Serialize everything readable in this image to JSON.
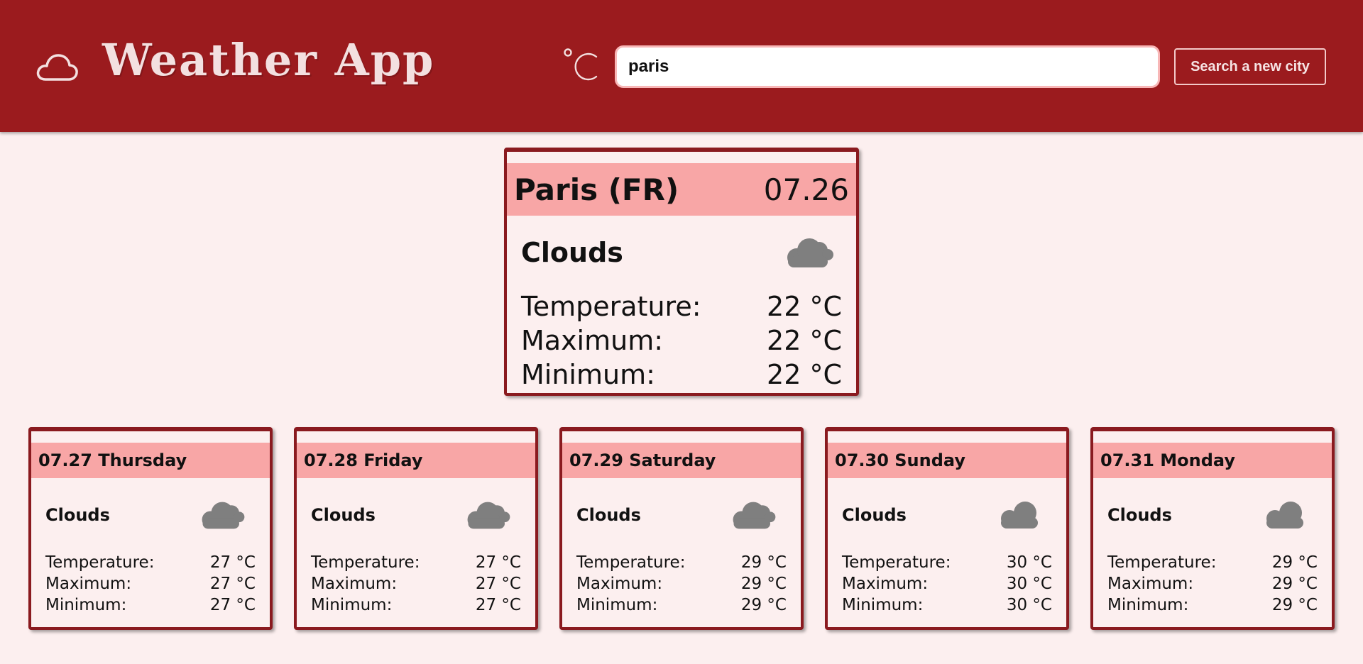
{
  "header": {
    "logo_icon": "cloud-outline-icon",
    "title": "Weather App",
    "unit_symbol": "°C",
    "search": {
      "value": "paris",
      "placeholder": ""
    },
    "search_button_label": "Search a new city"
  },
  "current": {
    "city": "Paris (FR)",
    "date": "07.26",
    "condition": "Clouds",
    "icon": "cloud-icon",
    "rows": [
      {
        "label": "Temperature:",
        "value": "22 °C"
      },
      {
        "label": "Maximum:",
        "value": "22 °C"
      },
      {
        "label": "Minimum:",
        "value": "22 °C"
      }
    ]
  },
  "forecast": [
    {
      "title": "07.27 Thursday",
      "condition": "Clouds",
      "icon": "broken-clouds-icon",
      "rows": [
        {
          "label": "Temperature:",
          "value": "27 °C"
        },
        {
          "label": "Maximum:",
          "value": "27 °C"
        },
        {
          "label": "Minimum:",
          "value": "27 °C"
        }
      ]
    },
    {
      "title": "07.28 Friday",
      "condition": "Clouds",
      "icon": "broken-clouds-icon",
      "rows": [
        {
          "label": "Temperature:",
          "value": "27 °C"
        },
        {
          "label": "Maximum:",
          "value": "27 °C"
        },
        {
          "label": "Minimum:",
          "value": "27 °C"
        }
      ]
    },
    {
      "title": "07.29 Saturday",
      "condition": "Clouds",
      "icon": "broken-clouds-icon",
      "rows": [
        {
          "label": "Temperature:",
          "value": "29 °C"
        },
        {
          "label": "Maximum:",
          "value": "29 °C"
        },
        {
          "label": "Minimum:",
          "value": "29 °C"
        }
      ]
    },
    {
      "title": "07.30 Sunday",
      "condition": "Clouds",
      "icon": "cloud-icon",
      "rows": [
        {
          "label": "Temperature:",
          "value": "30 °C"
        },
        {
          "label": "Maximum:",
          "value": "30 °C"
        },
        {
          "label": "Minimum:",
          "value": "30 °C"
        }
      ]
    },
    {
      "title": "07.31 Monday",
      "condition": "Clouds",
      "icon": "cloud-icon",
      "rows": [
        {
          "label": "Temperature:",
          "value": "29 °C"
        },
        {
          "label": "Maximum:",
          "value": "29 °C"
        },
        {
          "label": "Minimum:",
          "value": "29 °C"
        }
      ]
    }
  ],
  "colors": {
    "header_bg": "#9b1b1e",
    "page_bg": "#fcefef",
    "card_band": "#f8a6a6",
    "card_border": "#8a1a1f",
    "icon_gray": "#808080"
  }
}
